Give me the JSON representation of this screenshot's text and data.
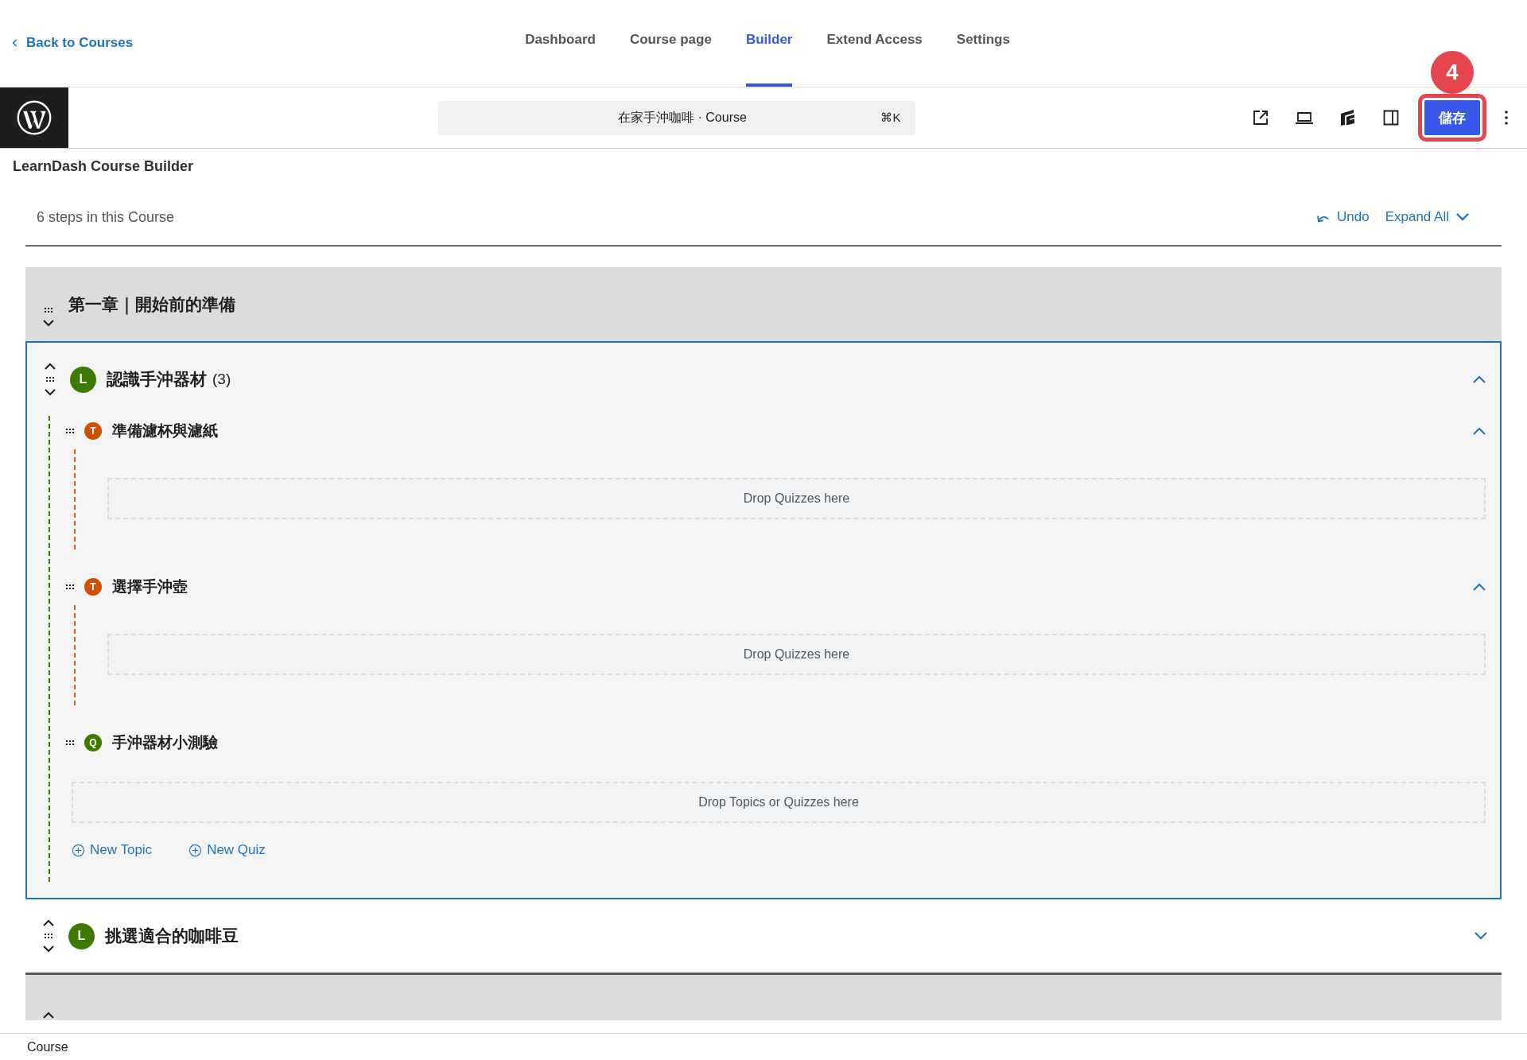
{
  "top_nav": {
    "back_link": "Back to Courses",
    "tabs": [
      {
        "label": "Dashboard",
        "selected": false
      },
      {
        "label": "Course page",
        "selected": false
      },
      {
        "label": "Builder",
        "selected": true
      },
      {
        "label": "Extend Access",
        "selected": false
      },
      {
        "label": "Settings",
        "selected": false
      }
    ]
  },
  "toolbar": {
    "command_bar": {
      "title": "在家手沖咖啡 · Course",
      "shortcut": "⌘K"
    },
    "save_button": "儲存",
    "annotation_badge": "4"
  },
  "page_title": "LearnDash Course Builder",
  "builder": {
    "steps_count": "6 steps in this Course",
    "undo": "Undo",
    "expand_all": "Expand All",
    "items": [
      {
        "kind": "section",
        "title": "第一章｜開始前的準備"
      },
      {
        "kind": "lesson",
        "badge": "L",
        "title": "認識手沖器材",
        "count": "(3)",
        "expanded": true,
        "drop_zone": "Drop Topics or Quizzes here",
        "actions": [
          "New Topic",
          "New Quiz"
        ],
        "children": [
          {
            "kind": "topic",
            "badge": "T",
            "title": "準備濾杯與濾紙",
            "expanded": true,
            "drop_zone": "Drop Quizzes here"
          },
          {
            "kind": "topic",
            "badge": "T",
            "title": "選擇手沖壺",
            "expanded": true,
            "drop_zone": "Drop Quizzes here"
          },
          {
            "kind": "quiz",
            "badge": "Q",
            "title": "手沖器材小測驗"
          }
        ]
      },
      {
        "kind": "lesson",
        "badge": "L",
        "title": "挑選適合的咖啡豆",
        "expanded": false
      },
      {
        "kind": "section"
      }
    ]
  },
  "footer": "Course"
}
